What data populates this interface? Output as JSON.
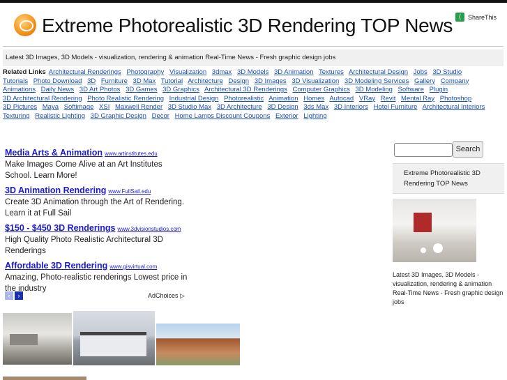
{
  "header": {
    "title": "Extreme Photorealistic 3D Rendering TOP News",
    "share_label": "ShareThis"
  },
  "tagline": "Latest 3D Images, 3D Models - visualization, rendering & animation Real-Time News - Fresh graphic design jobs",
  "related": {
    "label": "Related Links",
    "links": [
      "Architectural Renderings",
      "Photography",
      "Visualization",
      "3dmax",
      "3D Models",
      "3D Animation",
      "Textures",
      "Architectural Design",
      "Jobs",
      "3D Studio",
      "Tutorials",
      "Photo Download",
      "3D",
      "Furniture",
      "3D Max",
      "Tutorial",
      "Architecture",
      "Design",
      "3D Images",
      "3D Visualization",
      "3D Modeling Services",
      "Gallery",
      "Company",
      "Animations",
      "Daily News",
      "3D Art Photos",
      "3D Games",
      "3D Graphics",
      "Architectural 3D Renderings",
      "Computer Graphics",
      "3D Modeling",
      "Software",
      "Plugin",
      "3D Architectural Rendering",
      "Photo Realistic Rendering",
      "Industrial Design",
      "Photorealistic",
      "Animation",
      "Homes",
      "Autocad",
      "VRay",
      "Revit",
      "Mental Ray",
      "Photoshop",
      "3D Pictures",
      "Maya",
      "Softimage",
      "XSI",
      "Maxwell Render",
      "3D Studio Max",
      "3D Architecture",
      "3D Design",
      "3ds Max",
      "3D Interiors",
      "Hotel Furniture",
      "Architectural Interiors",
      "Texturing",
      "Realistic Lighting",
      "3D Graphic Design",
      "Decor",
      "Home Lamps Discount Coupons",
      "Exterior",
      "Lighting"
    ]
  },
  "ads": [
    {
      "title": "Media Arts & Animation",
      "url": "www.artinstitutes.edu",
      "desc": "Make Images Come Alive at an Art Institutes School. Learn More!"
    },
    {
      "title": "3D Animation Rendering",
      "url": "www.FullSail.edu",
      "desc": "Create 3D Animation through the Art of Rendering. Learn it at Full Sail"
    },
    {
      "title": "$150 - $450 3D Renderings",
      "url": "www.3dvisionstudios.com",
      "desc": "High Quality Photo Realistic Architectural 3D Renderings"
    },
    {
      "title": "Affordable 3D Rendering",
      "url": "www.gisvirtual.com",
      "desc": "Amazing, Photo-realistic renderings Lowest price in the industry"
    }
  ],
  "adchoices": "AdChoices ▷",
  "sidebar": {
    "search_button": "Search",
    "site_name": "Extreme Photorealistic 3D Rendering TOP News",
    "description": "Latest 3D Images, 3D Models - visualization, rendering & animation Real-Time News - Fresh graphic design jobs"
  }
}
